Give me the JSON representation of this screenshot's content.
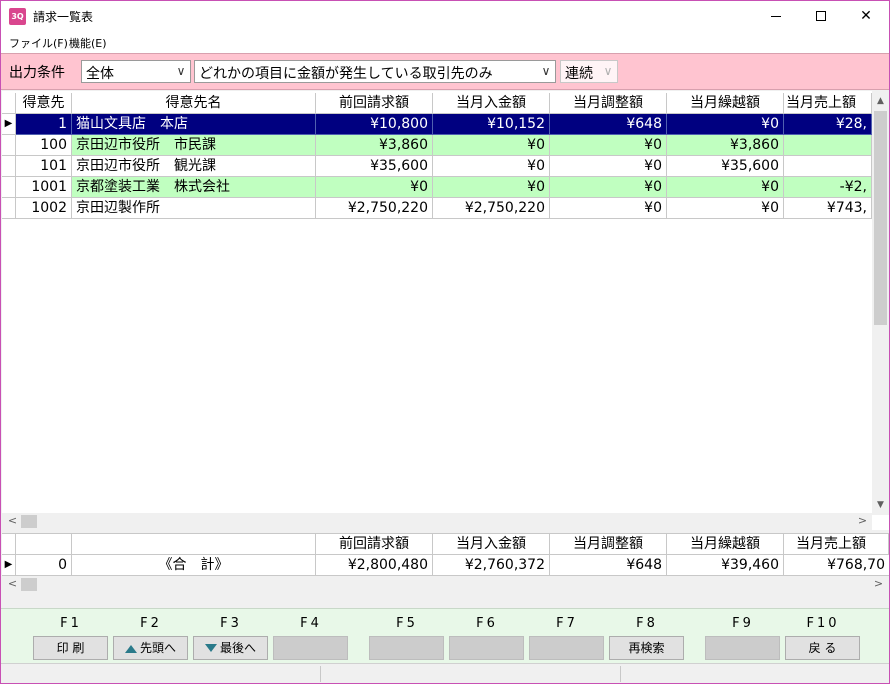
{
  "window": {
    "title": "請求一覧表",
    "icon_text": "3Q",
    "minimize_glyph": "",
    "close_glyph": "✕"
  },
  "menu": {
    "file": "ファイル(F)",
    "function": "機能(E)"
  },
  "filter": {
    "label": "出力条件",
    "type_value": "全体",
    "condition_value": "どれかの項目に金額が発生している取引先のみ",
    "mode_value": "連続"
  },
  "grid": {
    "headers": {
      "code": "得意先",
      "name": "得意先名",
      "prev": "前回請求額",
      "received": "当月入金額",
      "adjust": "当月調整額",
      "carry": "当月繰越額",
      "sales": "当月売上額"
    },
    "rows": [
      {
        "code": "1",
        "name": "猫山文具店　本店",
        "prev": "¥10,800",
        "received": "¥10,152",
        "adjust": "¥648",
        "carry": "¥0",
        "sales": "¥28,"
      },
      {
        "code": "100",
        "name": "京田辺市役所　市民課",
        "prev": "¥3,860",
        "received": "¥0",
        "adjust": "¥0",
        "carry": "¥3,860",
        "sales": ""
      },
      {
        "code": "101",
        "name": "京田辺市役所　観光課",
        "prev": "¥35,600",
        "received": "¥0",
        "adjust": "¥0",
        "carry": "¥35,600",
        "sales": ""
      },
      {
        "code": "1001",
        "name": "京都塗装工業　株式会社",
        "prev": "¥0",
        "received": "¥0",
        "adjust": "¥0",
        "carry": "¥0",
        "sales": "-¥2,"
      },
      {
        "code": "1002",
        "name": "京田辺製作所",
        "prev": "¥2,750,220",
        "received": "¥2,750,220",
        "adjust": "¥0",
        "carry": "¥0",
        "sales": "¥743,"
      }
    ]
  },
  "summary": {
    "headers": {
      "prev": "前回請求額",
      "received": "当月入金額",
      "adjust": "当月調整額",
      "carry": "当月繰越額",
      "sales": "当月売上額"
    },
    "count": "0",
    "label": "《合　計》",
    "prev": "¥2,800,480",
    "received": "¥2,760,372",
    "adjust": "¥648",
    "carry": "¥39,460",
    "sales": "¥768,70"
  },
  "function_keys": {
    "f1": {
      "key": "F1",
      "label": "印刷",
      "display": "印 刷"
    },
    "f2": {
      "key": "F2",
      "label": "先頭へ"
    },
    "f3": {
      "key": "F3",
      "label": "最後へ"
    },
    "f4": {
      "key": "F4",
      "label": ""
    },
    "f5": {
      "key": "F5",
      "label": ""
    },
    "f6": {
      "key": "F6",
      "label": ""
    },
    "f7": {
      "key": "F7",
      "label": ""
    },
    "f8": {
      "key": "F8",
      "label": "再検索"
    },
    "f9": {
      "key": "F9",
      "label": ""
    },
    "f10": {
      "key": "F10",
      "label": "戻る",
      "display": "戻 る"
    }
  },
  "colors": {
    "filter_bar": "#ffc4d0",
    "selected_row": "#000080",
    "alt_row": "#c0ffc0",
    "fkey_bar": "#e8f8e8",
    "app_icon": "#d9468e"
  },
  "icons": {
    "f2_icon": "arrow-up-icon",
    "f3_icon": "arrow-down-icon",
    "row_indicator": "row-pointer-icon"
  }
}
